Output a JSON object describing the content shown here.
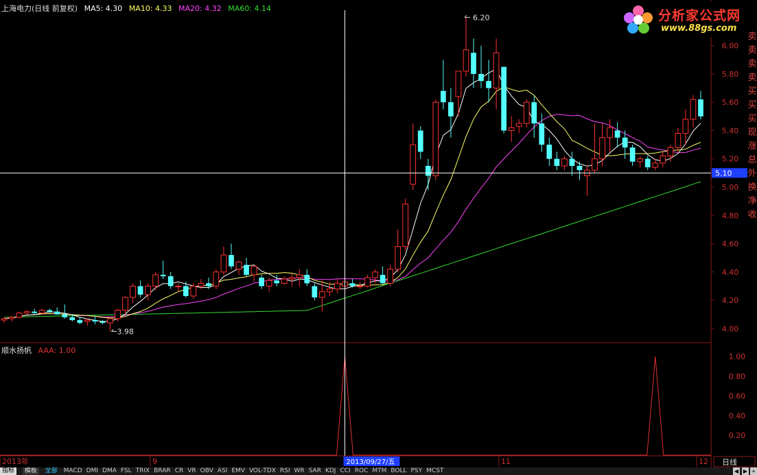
{
  "header": {
    "title": "上海电力(日线 前复权)",
    "ma5": "MA5: 4.30",
    "ma10": "MA10: 4.33",
    "ma20": "MA20: 4.32",
    "ma60": "MA60: 4.14",
    "colors": {
      "title": "#dddddd",
      "ma5": "#ffffff",
      "ma10": "#ffff66",
      "ma20": "#ff44ff",
      "ma60": "#33dd33"
    }
  },
  "indicator": {
    "name": "顺水扬帆",
    "value": "AAA: 1.00",
    "color": "#e03030"
  },
  "logo": {
    "title": "分析家公式网",
    "url": "www.88gs.com"
  },
  "price_axis": {
    "labels": [
      "6.00",
      "5.80",
      "5.60",
      "5.40",
      "5.20",
      "5.00",
      "4.80",
      "4.60",
      "4.40",
      "4.20",
      "4.00"
    ],
    "current": "5.10"
  },
  "indicator_axis": {
    "labels": [
      "1.00",
      "0.80",
      "0.60",
      "0.40",
      "0.20"
    ]
  },
  "annotations": {
    "high": "6.20",
    "low": "3.98"
  },
  "x_axis": {
    "labels": [
      "2013年",
      "9",
      "11",
      "12"
    ],
    "cursor_date": "2013/09/27/五",
    "period_button": "日线"
  },
  "side_labels": [
    "卖",
    "卖",
    "卖",
    "卖",
    "买",
    "买",
    "买",
    "现",
    "涨",
    "总",
    "外",
    "换",
    "净",
    "收"
  ],
  "bottom_tabs": {
    "tab1": "指标",
    "tab2": "模板",
    "all": "全部",
    "items": [
      "MACD",
      "DMI",
      "DMA",
      "FSL",
      "TRIX",
      "BRAR",
      "CR",
      "VR",
      "OBV",
      "ASI",
      "EMV",
      "VOL-TDX",
      "RSI",
      "WR",
      "SAR",
      "KDJ",
      "CCI",
      "ROC",
      "MTM",
      "BOLL",
      "PSY",
      "MCST"
    ]
  },
  "chart_data": {
    "type": "candlestick",
    "x": "trading days (index)",
    "candles": [
      [
        4.06,
        4.08,
        4.04,
        4.07
      ],
      [
        4.07,
        4.09,
        4.05,
        4.08
      ],
      [
        4.08,
        4.12,
        4.07,
        4.11
      ],
      [
        4.11,
        4.13,
        4.1,
        4.12
      ],
      [
        4.12,
        4.14,
        4.1,
        4.11
      ],
      [
        4.11,
        4.14,
        4.1,
        4.13
      ],
      [
        4.13,
        4.14,
        4.11,
        4.12
      ],
      [
        4.12,
        4.15,
        4.1,
        4.1
      ],
      [
        4.1,
        4.17,
        4.07,
        4.08
      ],
      [
        4.08,
        4.1,
        4.05,
        4.06
      ],
      [
        4.06,
        4.08,
        4.03,
        4.04
      ],
      [
        4.05,
        4.07,
        4.02,
        4.06
      ],
      [
        4.06,
        4.09,
        4.03,
        4.05
      ],
      [
        4.05,
        4.06,
        4.03,
        4.04
      ],
      [
        4.04,
        4.06,
        3.98,
        4.07
      ],
      [
        4.07,
        4.14,
        4.05,
        4.13
      ],
      [
        4.13,
        4.23,
        4.1,
        4.22
      ],
      [
        4.22,
        4.32,
        4.18,
        4.3
      ],
      [
        4.3,
        4.34,
        4.22,
        4.24
      ],
      [
        4.24,
        4.32,
        4.2,
        4.3
      ],
      [
        4.3,
        4.4,
        4.27,
        4.38
      ],
      [
        4.38,
        4.48,
        4.35,
        4.37
      ],
      [
        4.37,
        4.4,
        4.28,
        4.3
      ],
      [
        4.3,
        4.32,
        4.26,
        4.3
      ],
      [
        4.3,
        4.33,
        4.22,
        4.23
      ],
      [
        4.23,
        4.32,
        4.21,
        4.3
      ],
      [
        4.3,
        4.35,
        4.28,
        4.32
      ],
      [
        4.32,
        4.36,
        4.28,
        4.3
      ],
      [
        4.3,
        4.42,
        4.28,
        4.4
      ],
      [
        4.4,
        4.58,
        4.38,
        4.52
      ],
      [
        4.52,
        4.6,
        4.42,
        4.44
      ],
      [
        4.42,
        4.48,
        4.38,
        4.47
      ],
      [
        4.45,
        4.5,
        4.37,
        4.38
      ],
      [
        4.38,
        4.45,
        4.33,
        4.44
      ],
      [
        4.36,
        4.38,
        4.28,
        4.3
      ],
      [
        4.3,
        4.36,
        4.26,
        4.34
      ],
      [
        4.34,
        4.38,
        4.3,
        4.32
      ],
      [
        4.32,
        4.37,
        4.31,
        4.35
      ],
      [
        4.35,
        4.39,
        4.3,
        4.36
      ],
      [
        4.36,
        4.42,
        4.3,
        4.38
      ],
      [
        4.38,
        4.42,
        4.3,
        4.32
      ],
      [
        4.3,
        4.32,
        4.2,
        4.22
      ],
      [
        4.22,
        4.34,
        4.12,
        4.26
      ],
      [
        4.26,
        4.33,
        4.23,
        4.28
      ],
      [
        4.28,
        4.35,
        4.25,
        4.32
      ],
      [
        4.3,
        4.35,
        4.27,
        4.33
      ],
      [
        4.32,
        4.35,
        4.29,
        4.3
      ],
      [
        4.3,
        4.33,
        4.28,
        4.3
      ],
      [
        4.3,
        4.38,
        4.29,
        4.36
      ],
      [
        4.36,
        4.42,
        4.32,
        4.4
      ],
      [
        4.38,
        4.44,
        4.31,
        4.32
      ],
      [
        4.32,
        4.45,
        4.3,
        4.42
      ],
      [
        4.42,
        4.7,
        4.4,
        4.58
      ],
      [
        4.58,
        4.92,
        4.55,
        4.88
      ],
      [
        5.02,
        5.45,
        4.98,
        5.3
      ],
      [
        5.4,
        5.43,
        5.2,
        5.25
      ],
      [
        5.15,
        5.2,
        4.98,
        5.08
      ],
      [
        5.08,
        5.62,
        5.05,
        5.6
      ],
      [
        5.68,
        5.9,
        5.55,
        5.6
      ],
      [
        5.6,
        5.7,
        5.35,
        5.5
      ],
      [
        5.64,
        5.82,
        5.5,
        5.82
      ],
      [
        5.82,
        6.2,
        5.78,
        5.97
      ],
      [
        5.95,
        6.05,
        5.7,
        5.8
      ],
      [
        5.8,
        6.0,
        5.7,
        5.75
      ],
      [
        5.75,
        5.9,
        5.6,
        5.7
      ],
      [
        5.7,
        6.05,
        5.55,
        5.95
      ],
      [
        5.85,
        5.85,
        5.38,
        5.4
      ],
      [
        5.4,
        5.5,
        5.32,
        5.42
      ],
      [
        5.43,
        5.48,
        5.38,
        5.45
      ],
      [
        5.45,
        5.62,
        5.42,
        5.6
      ],
      [
        5.6,
        5.65,
        5.35,
        5.45
      ],
      [
        5.45,
        5.52,
        5.25,
        5.3
      ],
      [
        5.3,
        5.35,
        5.15,
        5.2
      ],
      [
        5.2,
        5.25,
        5.12,
        5.15
      ],
      [
        5.15,
        5.22,
        5.12,
        5.2
      ],
      [
        5.2,
        5.25,
        5.08,
        5.15
      ],
      [
        5.15,
        5.18,
        5.05,
        5.12
      ],
      [
        5.08,
        5.15,
        4.94,
        5.12
      ],
      [
        5.12,
        5.45,
        5.1,
        5.2
      ],
      [
        5.2,
        5.45,
        5.15,
        5.35
      ],
      [
        5.35,
        5.48,
        5.25,
        5.42
      ],
      [
        5.4,
        5.46,
        5.28,
        5.35
      ],
      [
        5.35,
        5.4,
        5.2,
        5.28
      ],
      [
        5.28,
        5.3,
        5.15,
        5.18
      ],
      [
        5.18,
        5.22,
        5.14,
        5.2
      ],
      [
        5.2,
        5.22,
        5.12,
        5.14
      ],
      [
        5.14,
        5.2,
        5.12,
        5.17
      ],
      [
        5.17,
        5.25,
        5.14,
        5.22
      ],
      [
        5.22,
        5.3,
        5.18,
        5.28
      ],
      [
        5.28,
        5.42,
        5.25,
        5.38
      ],
      [
        5.38,
        5.55,
        5.3,
        5.48
      ],
      [
        5.48,
        5.65,
        5.42,
        5.62
      ],
      [
        5.62,
        5.68,
        5.48,
        5.5
      ]
    ],
    "spikes_at_index": [
      45,
      86
    ]
  }
}
